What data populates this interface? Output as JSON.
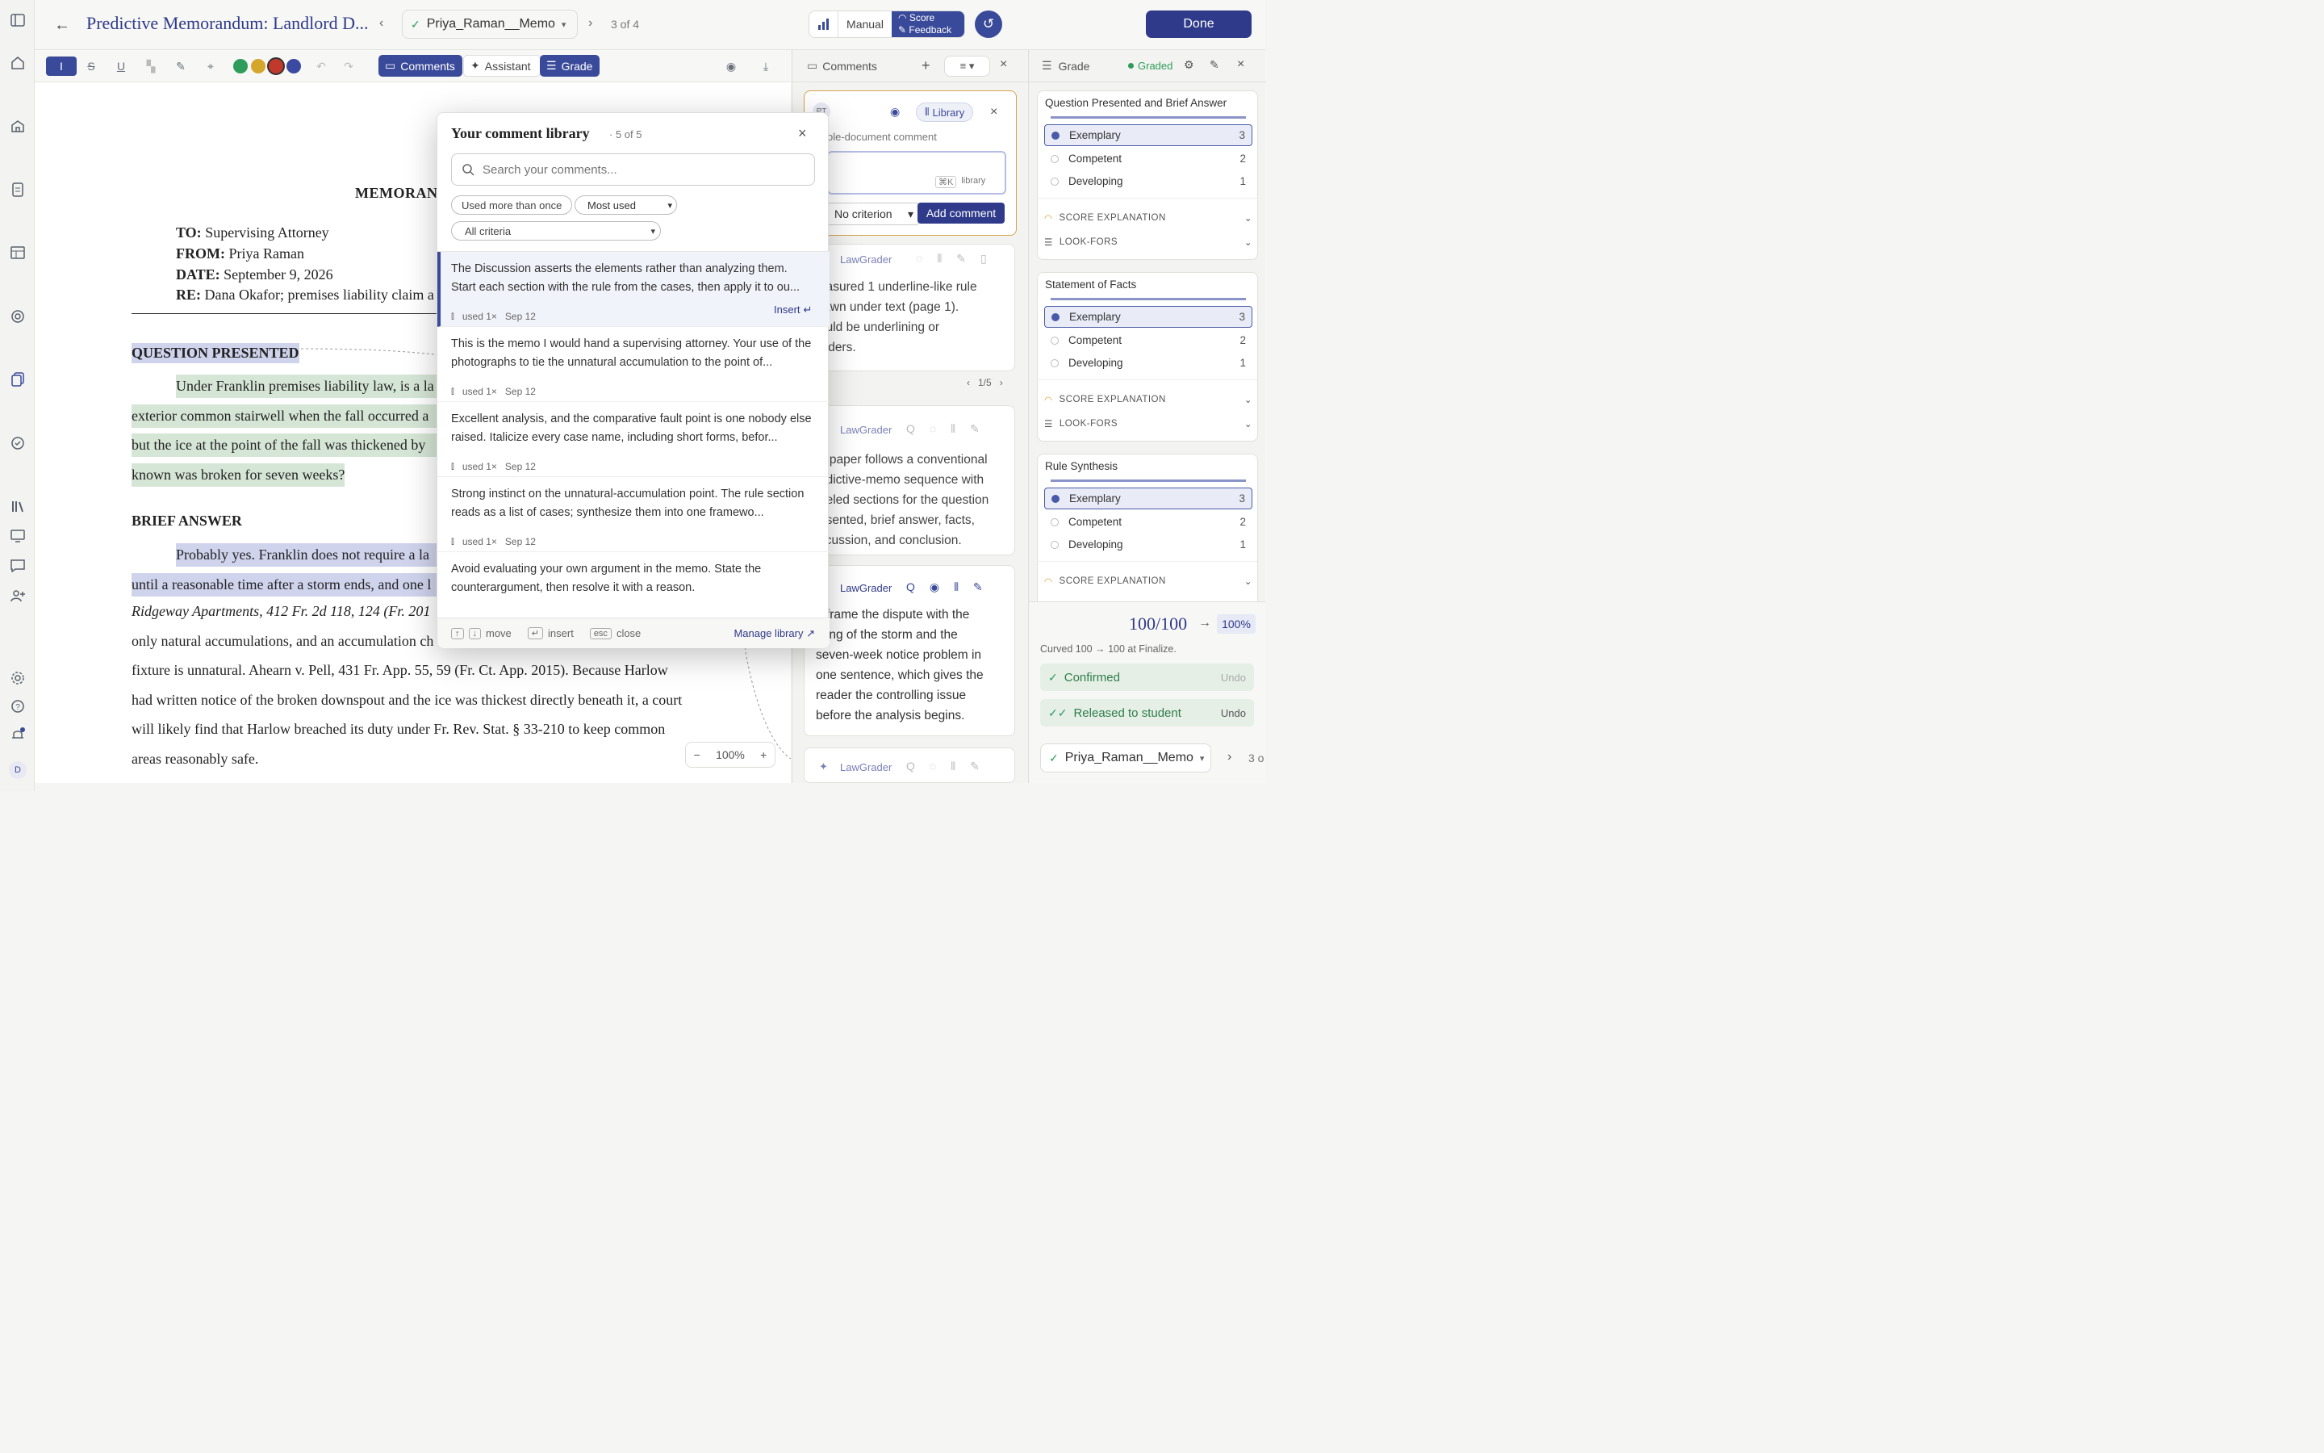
{
  "colors": {
    "brand": "#2f3a8a",
    "accent": "#3a4a9a",
    "graded": "#2e9d5b",
    "highlight_purple": "#cfd3ec",
    "highlight_green": "#d6e6d6"
  },
  "header": {
    "title": "Predictive Memorandum: Landlord D...",
    "student": "Priya_Raman__Memo",
    "position": "3 of 4",
    "mode_manual": "Manual",
    "score_label": "Score",
    "feedback_label": "Feedback",
    "done": "Done"
  },
  "toolbar": {
    "comments": "Comments",
    "assistant": "Assistant",
    "grade": "Grade",
    "colors": [
      "#2e9d5b",
      "#d4a72c",
      "#c0392b",
      "#3a4aa0"
    ]
  },
  "doc": {
    "memo_title": "MEMORAN",
    "to_label": "TO:",
    "to": " Supervising Attorney",
    "from_label": "FROM:",
    "from": " Priya Raman",
    "date_label": "DATE:",
    "date": " September 9, 2026",
    "re_label": "RE:",
    "re": " Dana Okafor; premises liability claim a",
    "qp_heading": "QUESTION PRESENTED",
    "qp_lines": [
      "Under Franklin premises liability law, is a la",
      "exterior common stairwell when the fall occurred a",
      "but the ice at the point of the fall was thickened by",
      "known was broken for seven weeks?"
    ],
    "ba_heading": "BRIEF ANSWER",
    "ba_lines": [
      "Probably yes. Franklin does not require a la",
      "until a reasonable time after a storm ends, and one l",
      "Ridgeway Apartments, 412 Fr. 2d 118, 124 (Fr. 201",
      "only natural accumulations, and an accumulation ch",
      "fixture is unnatural. Ahearn v. Pell, 431 Fr. App. 55, 59 (Fr. Ct. App. 2015). Because Harlow",
      "had written notice of the broken downspout and the ice was thickest directly beneath it, a court",
      "will likely find that Harlow breached its duty under Fr. Rev. Stat. § 33-210 to keep common",
      "areas reasonably safe."
    ],
    "zoom": "100%"
  },
  "library": {
    "title": "Your comment library",
    "count": "· 5 of 5",
    "search_placeholder": "Search your comments...",
    "filter_chip": "Used more than once",
    "sort": "Most used",
    "criteria": "All criteria",
    "items": [
      {
        "text": "The Discussion asserts the elements rather than analyzing them. Start each section with the rule from the cases, then apply it to ou...",
        "used": "used 1×",
        "date": "Sep 12",
        "action": "Insert"
      },
      {
        "text": "This is the memo I would hand a supervising attorney. Your use of the photographs to tie the unnatural accumulation to the point of...",
        "used": "used 1×",
        "date": "Sep 12"
      },
      {
        "text": "Excellent analysis, and the comparative fault point is one nobody else raised. Italicize every case name, including short forms, befor...",
        "used": "used 1×",
        "date": "Sep 12"
      },
      {
        "text": "Strong instinct on the unnatural-accumulation point. The rule section reads as a list of cases; synthesize them into one framewo...",
        "used": "used 1×",
        "date": "Sep 12"
      },
      {
        "text": "Avoid evaluating your own argument in the memo. State the counterargument, then resolve it with a reason.",
        "used": "",
        "date": ""
      }
    ],
    "footer": {
      "up": "↑",
      "down": "↓",
      "move": "move",
      "enter": "↵",
      "insert": "insert",
      "esc": "esc",
      "close": "close",
      "manage": "Manage library"
    }
  },
  "comments": {
    "title": "Comments",
    "draft": {
      "avatar": "PT",
      "library": "Library",
      "placeholder": "ole-document comment",
      "kbd": "⌘K",
      "kbd_label": "library",
      "criterion": "No criterion",
      "add": "Add comment"
    },
    "lawgrader": "LawGrader",
    "c1_lines": [
      "easured 1 underline-like rule",
      "rawn under text (page 1).",
      "ould be underlining or",
      "viders."
    ],
    "pager": "1/5",
    "c2_lines": [
      "e paper follows a conventional",
      "edictive-memo sequence with",
      "beled sections for the question",
      "esented, brief answer, facts,",
      "scussion, and conclusion."
    ],
    "c3_lines": [
      "u frame the dispute with the",
      "ming of the storm and the",
      "seven-week notice problem in",
      "one sentence, which gives the",
      "reader the controlling issue",
      "before the analysis begins."
    ]
  },
  "grade": {
    "title": "Grade",
    "status": "Graded",
    "criteria": [
      {
        "name": "Question Presented and Brief Answer",
        "options": [
          [
            "Exemplary",
            "3"
          ],
          [
            "Competent",
            "2"
          ],
          [
            "Developing",
            "1"
          ]
        ]
      },
      {
        "name": "Statement of Facts",
        "options": [
          [
            "Exemplary",
            "3"
          ],
          [
            "Competent",
            "2"
          ],
          [
            "Developing",
            "1"
          ]
        ]
      },
      {
        "name": "Rule Synthesis",
        "options": [
          [
            "Exemplary",
            "3"
          ],
          [
            "Competent",
            "2"
          ],
          [
            "Developing",
            "1"
          ]
        ]
      }
    ],
    "score_explanation": "SCORE EXPLANATION",
    "look_fors": "LOOK-FORS",
    "total": "100/100",
    "percent": "100%",
    "curved": "Curved 100 → 100 at Finalize.",
    "confirmed": "Confirmed",
    "released": "Released to student",
    "undo": "Undo",
    "student": "Priya_Raman__Memo",
    "next_short": "3 o"
  }
}
